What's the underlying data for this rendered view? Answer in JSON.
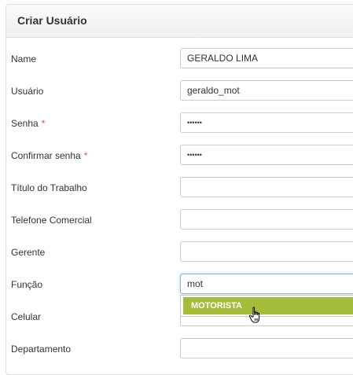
{
  "panel": {
    "title": "Criar Usuário"
  },
  "fields": [
    {
      "label": "Name",
      "value": "GERALDO LIMA",
      "required": false
    },
    {
      "label": "Usuário",
      "value": "geraldo_mot",
      "required": false
    },
    {
      "label": "Senha",
      "value": "••••••",
      "required": true
    },
    {
      "label": "Confirmar senha",
      "value": "••••••",
      "required": true
    },
    {
      "label": "Título do Trabalho",
      "value": "",
      "required": false
    },
    {
      "label": "Telefone Comercial",
      "value": "",
      "required": false
    },
    {
      "label": "Gerente",
      "value": "",
      "required": false
    },
    {
      "label": "Função",
      "value": "mot",
      "required": false
    },
    {
      "label": "Celular",
      "value": "",
      "required": false
    },
    {
      "label": "Departamento",
      "value": "",
      "required": false
    }
  ],
  "required_mark": "*",
  "autocomplete": {
    "options": [
      "MOTORISTA"
    ],
    "highlighted": "MOTORISTA"
  },
  "colors": {
    "highlight": "#a4be3c",
    "required": "#d9534f"
  },
  "icons": {
    "cursor": "hand-pointer-icon"
  }
}
